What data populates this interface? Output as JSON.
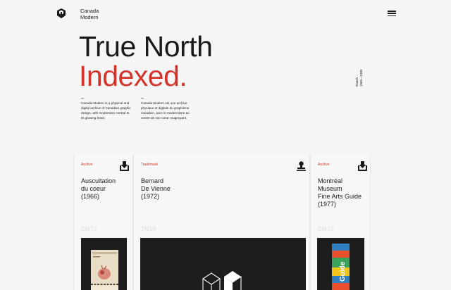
{
  "brand": {
    "name_line1": "Canada",
    "name_line2": "Modern",
    "logo_icon": "canada-modern-logo-icon",
    "menu_icon": "hamburger-menu-icon"
  },
  "hero": {
    "line1": "True North",
    "line2": "Indexed.",
    "accent_color": "#d2352c",
    "side_label_line1": "Ranch",
    "side_label_line2": "1960—1985"
  },
  "descriptions": {
    "english": "Canada Modern is a physical and digital archive of Canadian graphic design, with modernism central to its glowing heart.",
    "french": "Canada Modern est une archive physique et digitale du graphisme canadien, avec le modernisme au centre de son cœur rougeoyant."
  },
  "cards": [
    {
      "category": "Archive",
      "action_icon": "download-archive-icon",
      "title_lines": [
        "Auscultation",
        "du coeur",
        "(1966)"
      ],
      "code": "CM73"
    },
    {
      "category": "Trademark",
      "action_icon": "stamp-icon",
      "title_lines": [
        "Bernard",
        "De Vienne",
        "(1972)"
      ],
      "code": "TM18"
    },
    {
      "category": "Archive",
      "action_icon": "download-archive-icon",
      "title_lines": [
        "Montréal",
        "Museum",
        "Fine Arts Guide",
        "(1977)"
      ],
      "code": "CM72"
    }
  ],
  "thumbnails": {
    "card3_book_text": "Guide"
  }
}
